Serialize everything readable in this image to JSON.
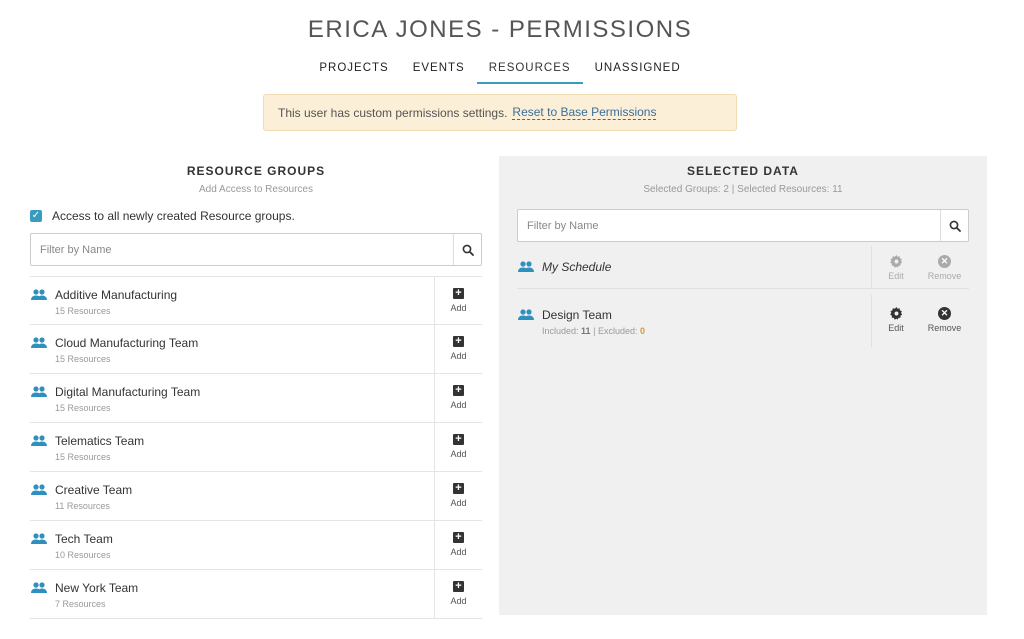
{
  "page": {
    "title": "ERICA JONES - PERMISSIONS"
  },
  "tabs": [
    {
      "label": "PROJECTS",
      "active": false
    },
    {
      "label": "EVENTS",
      "active": false
    },
    {
      "label": "RESOURCES",
      "active": true
    },
    {
      "label": "UNASSIGNED",
      "active": false
    }
  ],
  "notice": {
    "text": "This user has custom permissions settings.",
    "link": "Reset to Base Permissions"
  },
  "resource_groups": {
    "title": "RESOURCE GROUPS",
    "subtitle": "Add Access to Resources",
    "checkbox_label": "Access to all newly created Resource groups.",
    "checkbox_checked": true,
    "search_placeholder": "Filter by Name",
    "add_label": "Add",
    "groups": [
      {
        "name": "Additive Manufacturing",
        "count": "15 Resources"
      },
      {
        "name": "Cloud Manufacturing Team",
        "count": "15 Resources"
      },
      {
        "name": "Digital Manufacturing Team",
        "count": "15 Resources"
      },
      {
        "name": "Telematics Team",
        "count": "15 Resources"
      },
      {
        "name": "Creative Team",
        "count": "11 Resources"
      },
      {
        "name": "Tech Team",
        "count": "10 Resources"
      },
      {
        "name": "New York Team",
        "count": "7 Resources"
      }
    ]
  },
  "selected_data": {
    "title": "SELECTED DATA",
    "subtitle": "Selected Groups: 2 | Selected Resources: 11",
    "search_placeholder": "Filter by Name",
    "edit_label": "Edit",
    "remove_label": "Remove",
    "items": [
      {
        "name": "My Schedule",
        "italic": true,
        "disabled": true
      },
      {
        "name": "Design Team",
        "italic": false,
        "disabled": false,
        "included_label": "Included:",
        "included": "11",
        "separator": "|",
        "excluded_label": "Excluded:",
        "excluded": "0"
      }
    ]
  },
  "colors": {
    "accent": "#3a9bc0",
    "notice_bg": "#fcefd8",
    "excluded": "#d89a2c",
    "panel_bg": "#f0f0f0"
  },
  "icons": {
    "group": "people-icon",
    "search": "search-icon",
    "add": "plus-square-icon",
    "edit": "gear-icon",
    "remove": "close-circle-icon",
    "checkbox": "checkmark-icon"
  }
}
